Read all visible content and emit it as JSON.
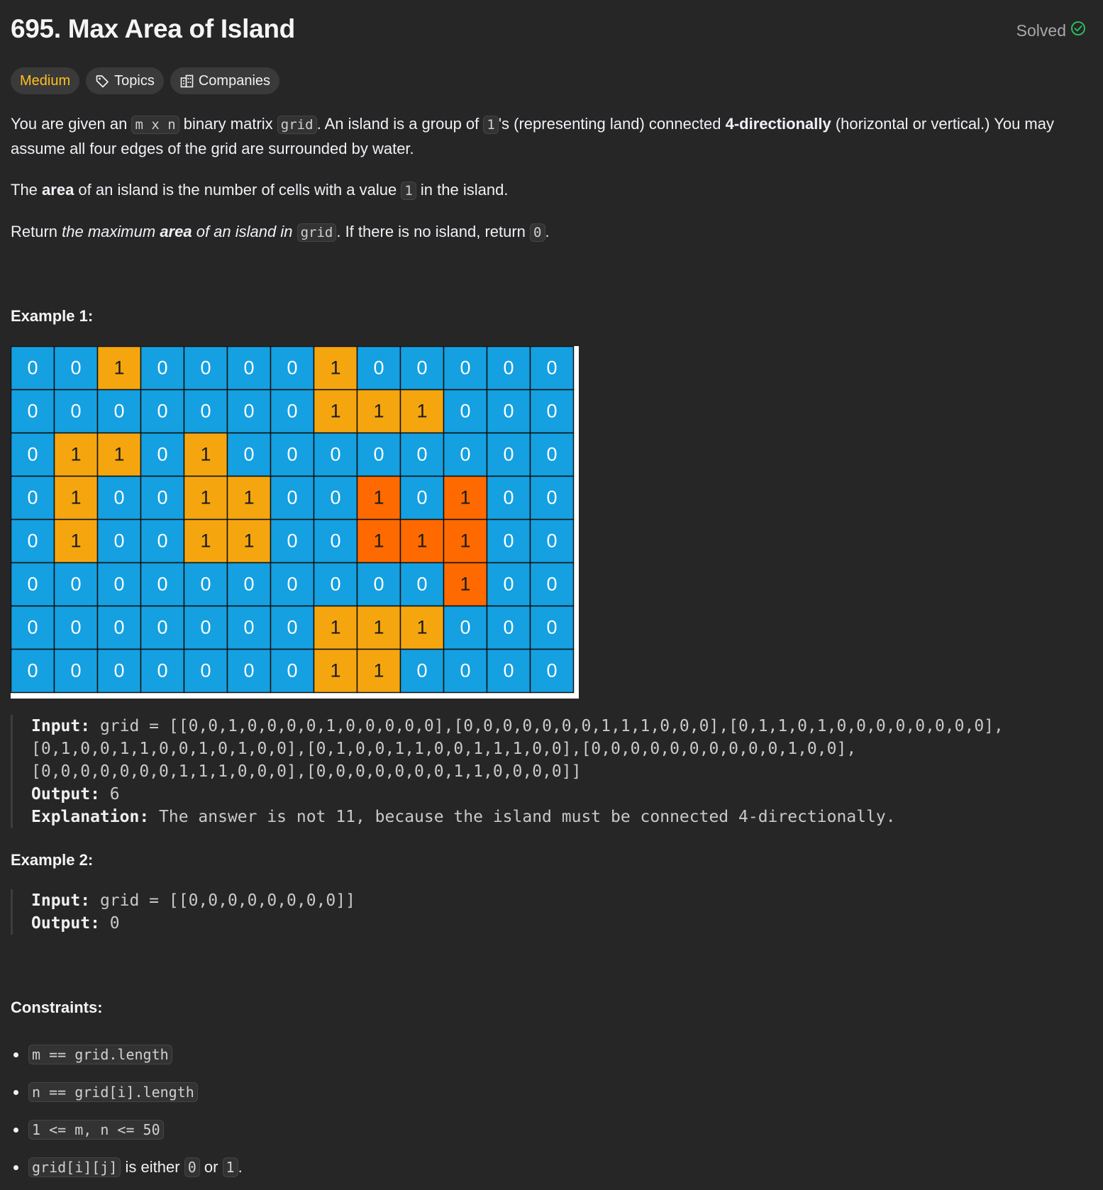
{
  "problem": {
    "title": "695. Max Area of Island",
    "solved_label": "Solved",
    "difficulty": "Medium",
    "topics_label": "Topics",
    "companies_label": "Companies"
  },
  "description": {
    "p1": {
      "t1": "You are given an ",
      "c1": "m x n",
      "t2": " binary matrix ",
      "c2": "grid",
      "t3": ". An island is a group of ",
      "c3": "1",
      "t4": "'s (representing land) connected ",
      "b1": "4-directionally",
      "t5": " (horizontal or vertical.) You may assume all four edges of the grid are surrounded by water."
    },
    "p2": {
      "t1": "The ",
      "b1": "area",
      "t2": " of an island is the number of cells with a value ",
      "c1": "1",
      "t3": " in the island."
    },
    "p3": {
      "t1": "Return ",
      "i1": "the maximum ",
      "bi1": "area",
      "i2": " of an island in ",
      "c1": "grid",
      "t2": ". If there is no island, return ",
      "c2": "0",
      "t3": "."
    }
  },
  "example1": {
    "heading": "Example 1:",
    "grid": [
      [
        0,
        0,
        1,
        0,
        0,
        0,
        0,
        1,
        0,
        0,
        0,
        0,
        0
      ],
      [
        0,
        0,
        0,
        0,
        0,
        0,
        0,
        1,
        1,
        1,
        0,
        0,
        0
      ],
      [
        0,
        1,
        1,
        0,
        1,
        0,
        0,
        0,
        0,
        0,
        0,
        0,
        0
      ],
      [
        0,
        1,
        0,
        0,
        1,
        1,
        0,
        0,
        1,
        0,
        1,
        0,
        0
      ],
      [
        0,
        1,
        0,
        0,
        1,
        1,
        0,
        0,
        1,
        1,
        1,
        0,
        0
      ],
      [
        0,
        0,
        0,
        0,
        0,
        0,
        0,
        0,
        0,
        0,
        1,
        0,
        0
      ],
      [
        0,
        0,
        0,
        0,
        0,
        0,
        0,
        1,
        1,
        1,
        0,
        0,
        0
      ],
      [
        0,
        0,
        0,
        0,
        0,
        0,
        0,
        1,
        1,
        0,
        0,
        0,
        0
      ]
    ],
    "highlight_cells": [
      [
        3,
        8
      ],
      [
        3,
        10
      ],
      [
        4,
        8
      ],
      [
        4,
        9
      ],
      [
        4,
        10
      ],
      [
        5,
        10
      ]
    ],
    "colors": {
      "water": "#14a0e1",
      "land": "#f5a60f",
      "max_island": "#ff6a00",
      "border": "#111111",
      "text": "#ffffff",
      "land_text": "#1a1a1a"
    },
    "input_label": "Input:",
    "input_lines": [
      " grid = [[0,0,1,0,0,0,0,1,0,0,0,0,0],[0,0,0,0,0,0,0,1,1,1,0,0,0],[0,1,1,0,1,0,0,0,0,0,0,0,0],",
      "[0,1,0,0,1,1,0,0,1,0,1,0,0],[0,1,0,0,1,1,0,0,1,1,1,0,0],[0,0,0,0,0,0,0,0,0,0,1,0,0],",
      "[0,0,0,0,0,0,0,1,1,1,0,0,0],[0,0,0,0,0,0,0,1,1,0,0,0,0]]"
    ],
    "output_label": "Output:",
    "output_value": " 6",
    "explanation_label": "Explanation:",
    "explanation_value": " The answer is not 11, because the island must be connected 4-directionally."
  },
  "example2": {
    "heading": "Example 2:",
    "input_label": "Input:",
    "input_value": " grid = [[0,0,0,0,0,0,0,0]]",
    "output_label": "Output:",
    "output_value": " 0"
  },
  "constraints": {
    "heading": "Constraints:",
    "c1": "m == grid.length",
    "c2": "n == grid[i].length",
    "c3": "1 <= m, n <= 50",
    "c4_code1": "grid[i][j]",
    "c4_t1": " is either ",
    "c4_code2": "0",
    "c4_t2": " or ",
    "c4_code3": "1",
    "c4_t3": "."
  },
  "icons": {
    "solved": "check-circle-icon",
    "topics": "tag-icon",
    "companies": "building-icon"
  }
}
